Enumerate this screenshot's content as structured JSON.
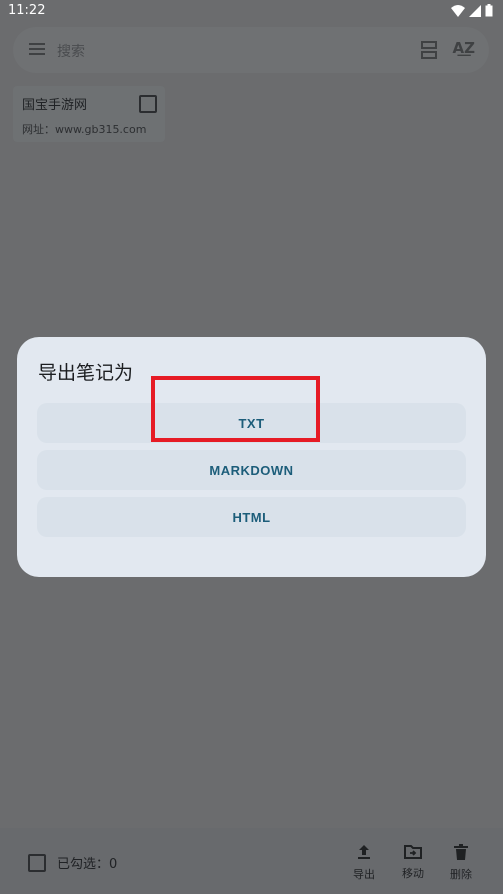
{
  "status_bar": {
    "time": "11:22"
  },
  "search": {
    "placeholder": "搜索"
  },
  "note": {
    "title": "国宝手游网",
    "url": "网址：www.gb315.com"
  },
  "dialog": {
    "title": "导出笔记为",
    "options": [
      "TXT",
      "MARKDOWN",
      "HTML"
    ]
  },
  "bottom": {
    "selected": "已勾选：0",
    "actions": [
      "导出",
      "移动",
      "删除"
    ]
  },
  "colors": {
    "highlight": "#e61b25",
    "accent_text": "#1c5d7a"
  }
}
